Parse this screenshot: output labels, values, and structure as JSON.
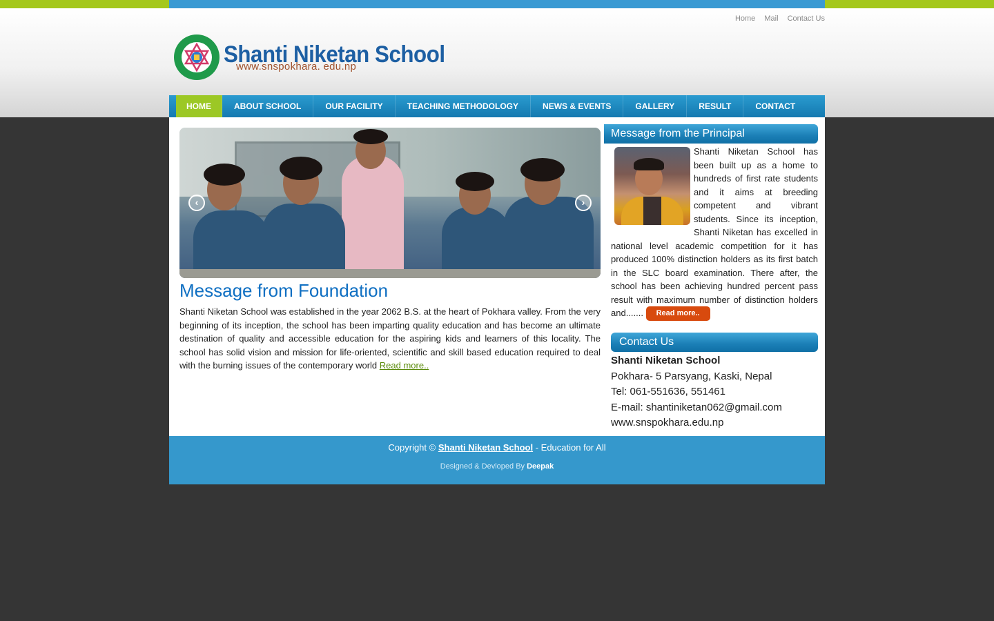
{
  "top_links": [
    "Home",
    "Mail",
    "Contact Us"
  ],
  "logo": {
    "name": "Shanti Niketan School",
    "url": "www.snspokhara. edu.np",
    "seal_text": "SHANTI NIKETAN SCHOOL Mahepatan, Pokhara 5"
  },
  "nav": [
    {
      "label": "HOME",
      "active": true
    },
    {
      "label": "ABOUT SCHOOL",
      "active": false
    },
    {
      "label": "OUR FACILITY",
      "active": false
    },
    {
      "label": "TEACHING METHODOLOGY",
      "active": false
    },
    {
      "label": "NEWS & EVENTS",
      "active": false
    },
    {
      "label": "GALLERY",
      "active": false
    },
    {
      "label": "RESULT",
      "active": false
    },
    {
      "label": "CONTACT",
      "active": false
    }
  ],
  "slider": {
    "prev_icon": "chevron-left-icon",
    "next_icon": "chevron-right-icon",
    "prev_glyph": "‹",
    "next_glyph": "›"
  },
  "foundation": {
    "title": "Message from Foundation",
    "text": "Shanti Niketan School was established in the year 2062 B.S. at the heart of Pokhara valley. From the very beginning of its inception, the school has been imparting quality education and has become an ultimate destination of quality and accessible education for the aspiring kids and learners of this locality. The school has solid vision and mission for life-oriented, scientific and skill based education required to deal with the burning issues of the contemporary world",
    "read_more": "Read more.."
  },
  "principal": {
    "title": "Message from the Principal",
    "text": "Shanti Niketan School has been built up as a home to hundreds of first rate students and it aims at breeding competent and vibrant students. Since its inception, Shanti Niketan has excelled in national level academic competition for it has produced 100% distinction holders as its first batch in the SLC board examination. There after, the school has been achieving hundred percent pass result with maximum number of distinction holders and.......",
    "read_more": "Read more.."
  },
  "contact": {
    "title": "Contact Us",
    "name": "Shanti Niketan School",
    "address": "Pokhara- 5 Parsyang, Kaski, Nepal",
    "tel": "Tel: 061-551636, 551461",
    "email": "E-mail: shantiniketan062@gmail.com",
    "web": "www.snspokhara.edu.np"
  },
  "footer": {
    "copy_prefix": "Copyright ©",
    "copy_link": "Shanti Niketan School",
    "copy_suffix": "- Education for All",
    "designed_prefix": "Designed & Devloped By",
    "designed_by": "Deepak"
  },
  "colors": {
    "accent_blue": "#3a9ad3",
    "accent_green": "#a5c81c",
    "nav_active": "#9cc825",
    "read_more_button": "#d84a0e"
  }
}
